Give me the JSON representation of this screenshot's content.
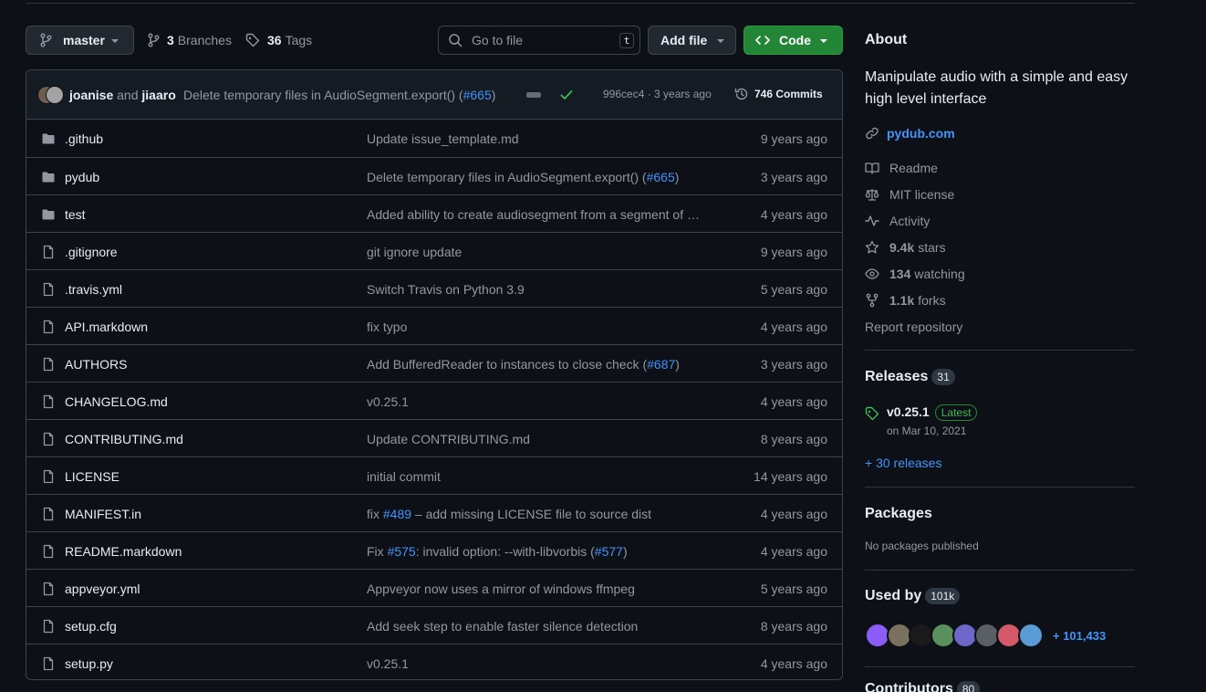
{
  "toolbar": {
    "branch": "master",
    "branches_count": "3",
    "branches_label": "Branches",
    "tags_count": "36",
    "tags_label": "Tags",
    "search_placeholder": "Go to file",
    "search_key": "t",
    "add_file": "Add file",
    "code": "Code"
  },
  "commit": {
    "author1": "joanise",
    "and": "and",
    "author2": "jiaaro",
    "message": "Delete temporary files in AudioSegment.export() (",
    "pr": "#665",
    "message_end": ")",
    "hash_age": "996cec4 · 3 years ago",
    "commits_count": "746 Commits"
  },
  "files": [
    {
      "name": ".github",
      "type": "folder",
      "msg": "Update issue_template.md",
      "age": "9 years ago"
    },
    {
      "name": "pydub",
      "type": "folder",
      "msg_parts": [
        "Delete temporary files in AudioSegment.export() (",
        "#665",
        ")"
      ],
      "age": "3 years ago"
    },
    {
      "name": "test",
      "type": "folder",
      "msg": "Added ability to create audiosegment from a segment of …",
      "age": "4 years ago"
    },
    {
      "name": ".gitignore",
      "type": "file",
      "msg": "git ignore update",
      "age": "9 years ago"
    },
    {
      "name": ".travis.yml",
      "type": "file",
      "msg": "Switch Travis on Python 3.9",
      "age": "5 years ago"
    },
    {
      "name": "API.markdown",
      "type": "file",
      "msg": "fix typo",
      "age": "4 years ago"
    },
    {
      "name": "AUTHORS",
      "type": "file",
      "msg_parts": [
        "Add BufferedReader to instances to close check (",
        "#687",
        ")"
      ],
      "age": "3 years ago"
    },
    {
      "name": "CHANGELOG.md",
      "type": "file",
      "msg": "v0.25.1",
      "age": "4 years ago"
    },
    {
      "name": "CONTRIBUTING.md",
      "type": "file",
      "msg": "Update CONTRIBUTING.md",
      "age": "8 years ago"
    },
    {
      "name": "LICENSE",
      "type": "file",
      "msg": "initial commit",
      "age": "14 years ago"
    },
    {
      "name": "MANIFEST.in",
      "type": "file",
      "msg_parts": [
        "fix ",
        "#489",
        " – add missing LICENSE file to source dist"
      ],
      "age": "4 years ago"
    },
    {
      "name": "README.markdown",
      "type": "file",
      "msg_parts": [
        "Fix ",
        "#575",
        ": invalid option: --with-libvorbis (",
        "#577",
        ")"
      ],
      "age": "4 years ago"
    },
    {
      "name": "appveyor.yml",
      "type": "file",
      "msg": "Appveyor now uses a mirror of windows ffmpeg",
      "age": "5 years ago"
    },
    {
      "name": "setup.cfg",
      "type": "file",
      "msg": "Add seek step to enable faster silence detection",
      "age": "8 years ago"
    },
    {
      "name": "setup.py",
      "type": "file",
      "msg": "v0.25.1",
      "age": "4 years ago"
    }
  ],
  "about": {
    "title": "About",
    "description": "Manipulate audio with a simple and easy high level interface",
    "website": "pydub.com",
    "readme": "Readme",
    "license": "MIT license",
    "activity": "Activity",
    "stars_count": "9.4k",
    "stars_label": "stars",
    "watching_count": "134",
    "watching_label": "watching",
    "forks_count": "1.1k",
    "forks_label": "forks",
    "report": "Report repository"
  },
  "releases": {
    "title": "Releases",
    "count": "31",
    "latest_tag": "v0.25.1",
    "latest_badge": "Latest",
    "latest_date": "on Mar 10, 2021",
    "more": "+ 30 releases"
  },
  "packages": {
    "title": "Packages",
    "empty": "No packages published"
  },
  "used_by": {
    "title": "Used by",
    "count": "101k",
    "more": "+ 101,433"
  },
  "contributors": {
    "title": "Contributors",
    "count": "80"
  },
  "colors": {
    "background": "#0d1117",
    "link": "#4493f8",
    "code_button": "#238636",
    "success": "#3fb950"
  }
}
